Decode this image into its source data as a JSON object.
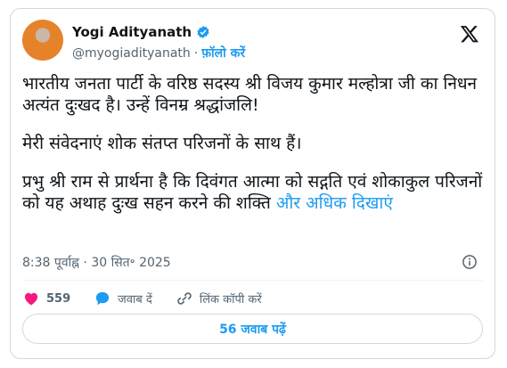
{
  "author": {
    "name": "Yogi Adityanath",
    "handle": "@myogiadityanath",
    "follow_label": "फ़ॉलो करें"
  },
  "post": {
    "paragraph1": "भारतीय जनता पार्टी के वरिष्ठ सदस्य श्री विजय कुमार मल्होत्रा जी का निधन अत्यंत दुःखद है। उन्हें विनम्र श्रद्धांजलि!",
    "paragraph2": "मेरी संवेदनाएं शोक संतप्त परिजनों के साथ हैं।",
    "paragraph3": "प्रभु श्री राम से प्रार्थना है कि दिवंगत आत्मा को सद्गति एवं शोकाकुल परिजनों को यह अथाह दुःख सहन करने की शक्ति ",
    "show_more": "और अधिक दिखाएं",
    "time": "8:38 पूर्वाह्न",
    "date": "30 सित॰ 2025",
    "separator": "·"
  },
  "actions": {
    "likes": "559",
    "reply_label": "जवाब दें",
    "copy_link_label": "लिंक कॉपी करें"
  },
  "read_replies_label": "56 जवाब पढ़ें",
  "icons": {
    "verified": "verified-badge-icon",
    "x_logo": "x-logo-icon",
    "info": "info-icon",
    "heart": "heart-icon",
    "reply": "reply-bubble-icon",
    "link": "link-icon"
  },
  "colors": {
    "accent": "#1d9bf0",
    "like": "#f91880",
    "text": "#0f1419",
    "muted": "#536471"
  }
}
